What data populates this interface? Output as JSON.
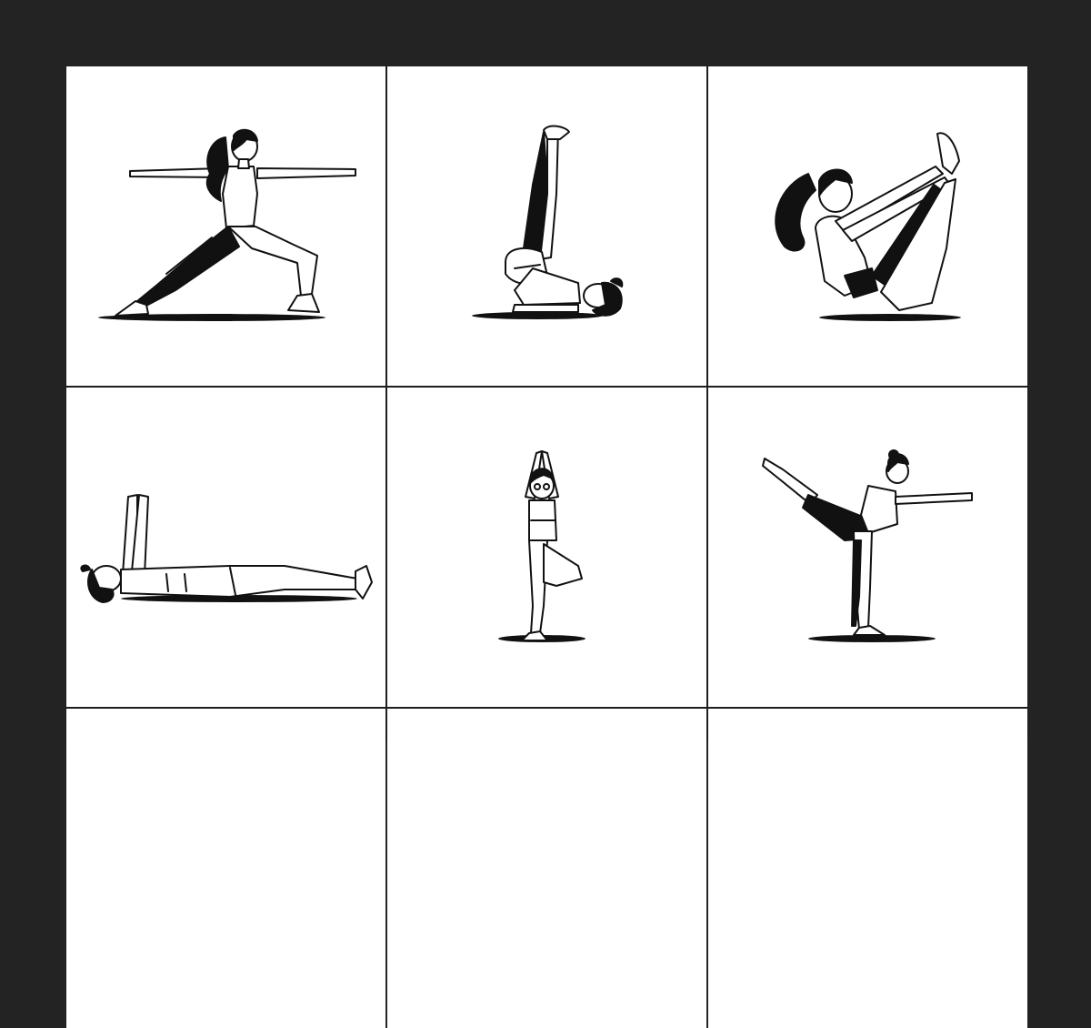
{
  "background_color": "#232323",
  "panel_color": "#ffffff",
  "ink_color": "#111111",
  "poses": [
    {
      "icon": "warrior-two-pose-figure"
    },
    {
      "icon": "shoulder-stand-pose-figure"
    },
    {
      "icon": "boat-pose-figure"
    },
    {
      "icon": "supine-arms-raised-pose-figure"
    },
    {
      "icon": "tree-pose-figure"
    },
    {
      "icon": "dancer-pose-figure"
    },
    {
      "icon": "cropped-pose-figure"
    },
    {
      "icon": "cropped-pose-figure"
    },
    {
      "icon": "cropped-pose-figure"
    }
  ]
}
